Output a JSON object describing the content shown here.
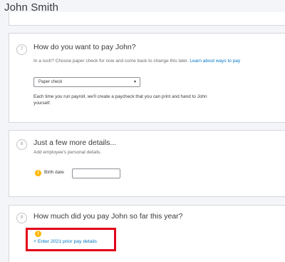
{
  "header": {
    "title": "John Smith"
  },
  "sections": {
    "pay_method": {
      "step": "7",
      "title": "How do you want to pay John?",
      "subtitle": "In a rush? Choose paper check for now and come back to change this later.",
      "learn_link": "Learn about ways to pay",
      "select_value": "Paper check",
      "description": "Each time you run payroll, we'll create a paycheck that you can print and hand to John yourself."
    },
    "details": {
      "step": "8",
      "title": "Just a few more details...",
      "subtitle": "Add employee's personal details.",
      "birth_date_label": "Birth date",
      "birth_date_value": ""
    },
    "ytd": {
      "step": "9",
      "title": "How much did you pay John so far this year?",
      "enter_link": "+ Enter 2021 prior pay details"
    }
  },
  "icons": {
    "warning": "!",
    "chevron": "▾"
  },
  "colors": {
    "link": "#0077c5",
    "warning": "#ffb700",
    "highlight": "#e2001a",
    "background": "#f4f5f8"
  }
}
